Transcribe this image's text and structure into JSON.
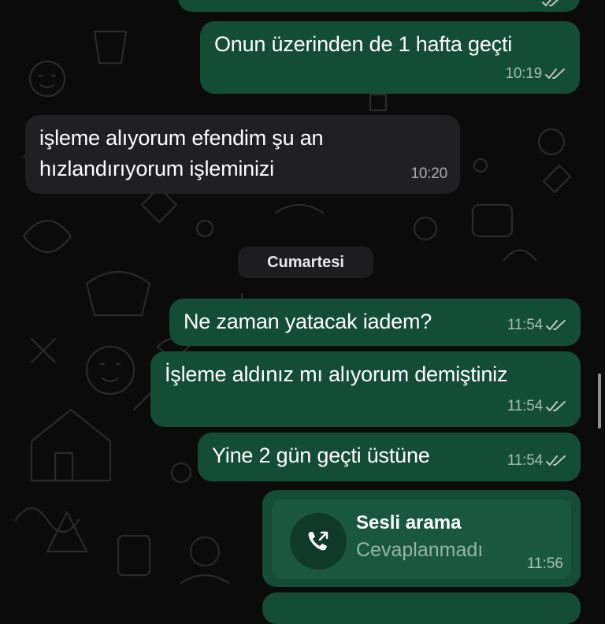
{
  "messages": [
    {
      "text": "Onun üzerinden de 1 hafta geçti",
      "time": "10:19",
      "direction": "outgoing",
      "status": "read"
    },
    {
      "lines": [
        "işleme alıyorum efendim şu an",
        "hızlandırıyorum işleminizi"
      ],
      "time": "10:20",
      "direction": "incoming"
    },
    {
      "text": "Ne zaman yatacak iadem?",
      "time": "11:54",
      "direction": "outgoing",
      "status": "read"
    },
    {
      "text": "İşleme aldınız mı alıyorum demiştiniz",
      "time": "11:54",
      "direction": "outgoing",
      "status": "read"
    },
    {
      "text": "Yine 2 gün geçti üstüne",
      "time": "11:54",
      "direction": "outgoing",
      "status": "read"
    }
  ],
  "date_separator": "Cumartesi",
  "call": {
    "title": "Sesli arama",
    "status": "Cevaplanmadı",
    "time": "11:56",
    "icon": "outgoing-call-icon"
  },
  "colors": {
    "outgoing_bubble": "#144d37",
    "incoming_bubble": "#202022",
    "background": "#0b0b0b",
    "read_ticks": "#b9c7c0"
  }
}
